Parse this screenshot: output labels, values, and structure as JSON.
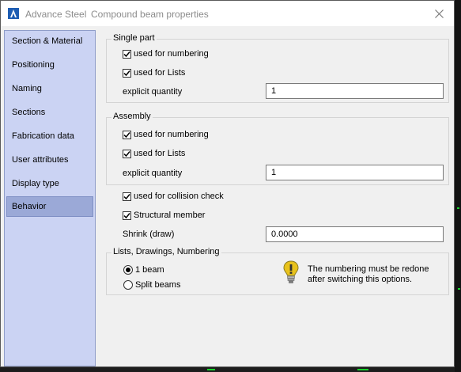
{
  "titlebar": {
    "app_name": "Advance Steel",
    "dialog_title": "Compound beam properties",
    "close_glyph": "✕"
  },
  "sidebar": {
    "items": [
      {
        "label": "Section & Material"
      },
      {
        "label": "Positioning"
      },
      {
        "label": "Naming"
      },
      {
        "label": "Sections"
      },
      {
        "label": "Fabrication data"
      },
      {
        "label": "User attributes"
      },
      {
        "label": "Display type"
      },
      {
        "label": "Behavior",
        "selected": true
      }
    ]
  },
  "single_part": {
    "legend": "Single part",
    "numbering_label": "used for numbering",
    "numbering_checked": true,
    "lists_label": "used for Lists",
    "lists_checked": true,
    "quantity_label": "explicit quantity",
    "quantity_value": "1"
  },
  "assembly": {
    "legend": "Assembly",
    "numbering_label": "used for numbering",
    "numbering_checked": true,
    "lists_label": "used for Lists",
    "lists_checked": true,
    "quantity_label": "explicit quantity",
    "quantity_value": "1"
  },
  "general": {
    "collision_label": "used for collision check",
    "collision_checked": true,
    "structural_label": "Structural member",
    "structural_checked": true,
    "shrink_label": "Shrink (draw)",
    "shrink_value": "0.0000"
  },
  "lists_group": {
    "legend": "Lists, Drawings, Numbering",
    "options": [
      {
        "label": "1 beam",
        "selected": true
      },
      {
        "label": "Split beams",
        "selected": false
      }
    ],
    "info_text_line1": "The numbering must be redone",
    "info_text_line2": "after switching this options."
  },
  "colors": {
    "sidebar_bg": "#cbd3f3",
    "sidebar_selected": "#9ba9d7",
    "app_logo": "#1e5db3",
    "info_icon": "#e8c21c"
  },
  "icons": [
    "app-logo-icon",
    "close-icon",
    "checkbox-check-icon",
    "info-bulb-icon"
  ]
}
